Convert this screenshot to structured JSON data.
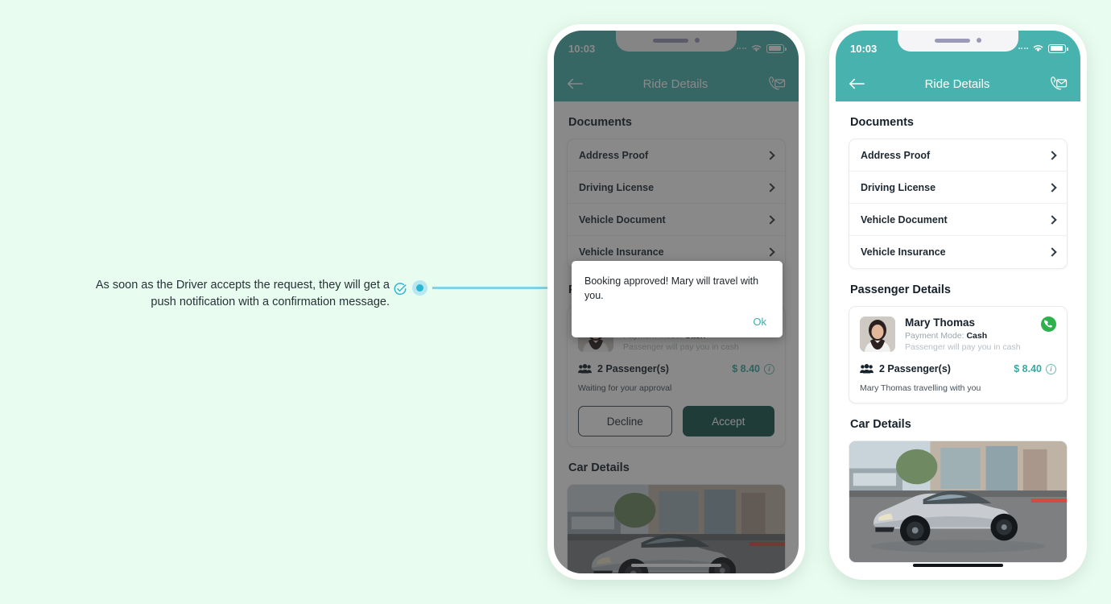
{
  "background_color": "#e9fcf0",
  "accent_color": "#48b3ae",
  "annotation": {
    "text": "As soon as the Driver accepts the request, they will get a push notification with a confirmation message.",
    "check_icon": "check-circle-icon",
    "marker_icon": "dot-marker-icon"
  },
  "phone": {
    "status": {
      "time": "10:03",
      "wifi_icon": "wifi-icon",
      "battery_icon": "battery-icon"
    },
    "appbar": {
      "back_icon": "arrow-left-icon",
      "title": "Ride Details",
      "contact_icon": "phone-envelope-icon"
    },
    "documents": {
      "title": "Documents",
      "items": [
        {
          "label": "Address Proof",
          "chevron": "chevron-right-icon"
        },
        {
          "label": "Driving License",
          "chevron": "chevron-right-icon"
        },
        {
          "label": "Vehicle Document",
          "chevron": "chevron-right-icon"
        },
        {
          "label": "Vehicle Insurance",
          "chevron": "chevron-right-icon"
        }
      ]
    },
    "passenger": {
      "title": "Passenger Details",
      "name": "Mary Thomas",
      "payment_label": "Payment Mode:",
      "payment_value": "Cash",
      "payment_note": "Passenger will pay you in cash",
      "call_icon": "phone-call-icon",
      "count": "2 Passenger(s)",
      "price": "$ 8.40",
      "info_icon": "info-icon",
      "status_pending": "Waiting for your approval",
      "status_confirmed": "Mary Thomas travelling with you",
      "decline_label": "Decline",
      "accept_label": "Accept"
    },
    "car": {
      "title": "Car Details",
      "photo_alt": "silver-sedan-photo"
    }
  },
  "dialog": {
    "message": "Booking approved! Mary will travel with you.",
    "ok_label": "Ok"
  }
}
